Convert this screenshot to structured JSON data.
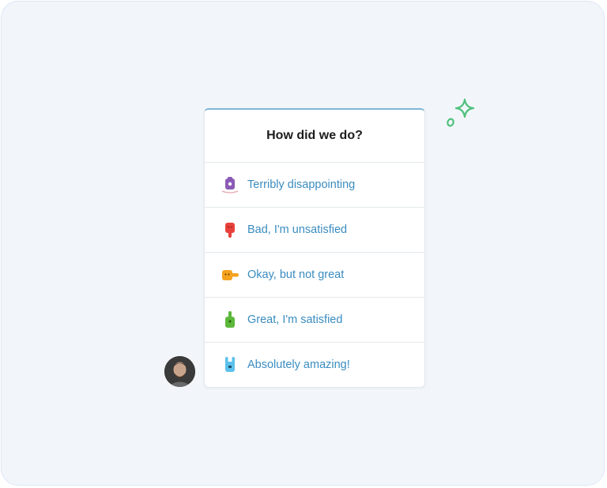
{
  "survey": {
    "title": "How did we do?",
    "options": [
      {
        "label": "Terribly disappointing",
        "icon": "purple-sad-face-icon",
        "color": "#8a5bb5"
      },
      {
        "label": "Bad, I'm unsatisfied",
        "icon": "red-thumbs-down-icon",
        "color": "#e8413a"
      },
      {
        "label": "Okay, but not great",
        "icon": "orange-sideways-thumb-icon",
        "color": "#f5a21e"
      },
      {
        "label": "Great, I'm satisfied",
        "icon": "green-thumbs-up-icon",
        "color": "#5cb83a"
      },
      {
        "label": "Absolutely amazing!",
        "icon": "blue-rock-hand-icon",
        "color": "#5bc0eb"
      }
    ]
  },
  "decorations": {
    "sparkle_color": "#4fc07c",
    "accent_border": "#7fb6d8"
  }
}
